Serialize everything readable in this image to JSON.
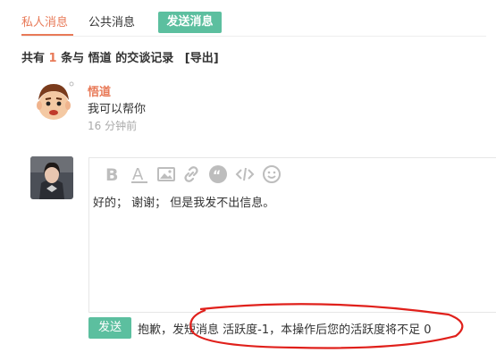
{
  "tabs": [
    {
      "label": "私人消息",
      "active": true
    },
    {
      "label": "公共消息",
      "active": false
    }
  ],
  "send_top_label": "发送消息",
  "summary": {
    "prefix": "共有",
    "count": "1",
    "middle": "条与",
    "user": "悟道",
    "suffix": "的交谈记录",
    "export": "[导出]"
  },
  "message": {
    "author": "悟道",
    "text": "我可以帮你",
    "time": "16 分钟前"
  },
  "editor": {
    "toolbar": [
      "bold-icon",
      "font-color-icon",
      "image-icon",
      "link-icon",
      "quote-icon",
      "code-icon",
      "emoji-icon"
    ],
    "content": "好的； 谢谢； 但是我发不出信息。"
  },
  "send_label": "发送",
  "error": "抱歉，发短消息 活跃度-1，本操作后您的活跃度将不足 0",
  "colors": {
    "accent": "#e87a58",
    "green": "#5cbf9f",
    "annotation": "#e0201b"
  }
}
